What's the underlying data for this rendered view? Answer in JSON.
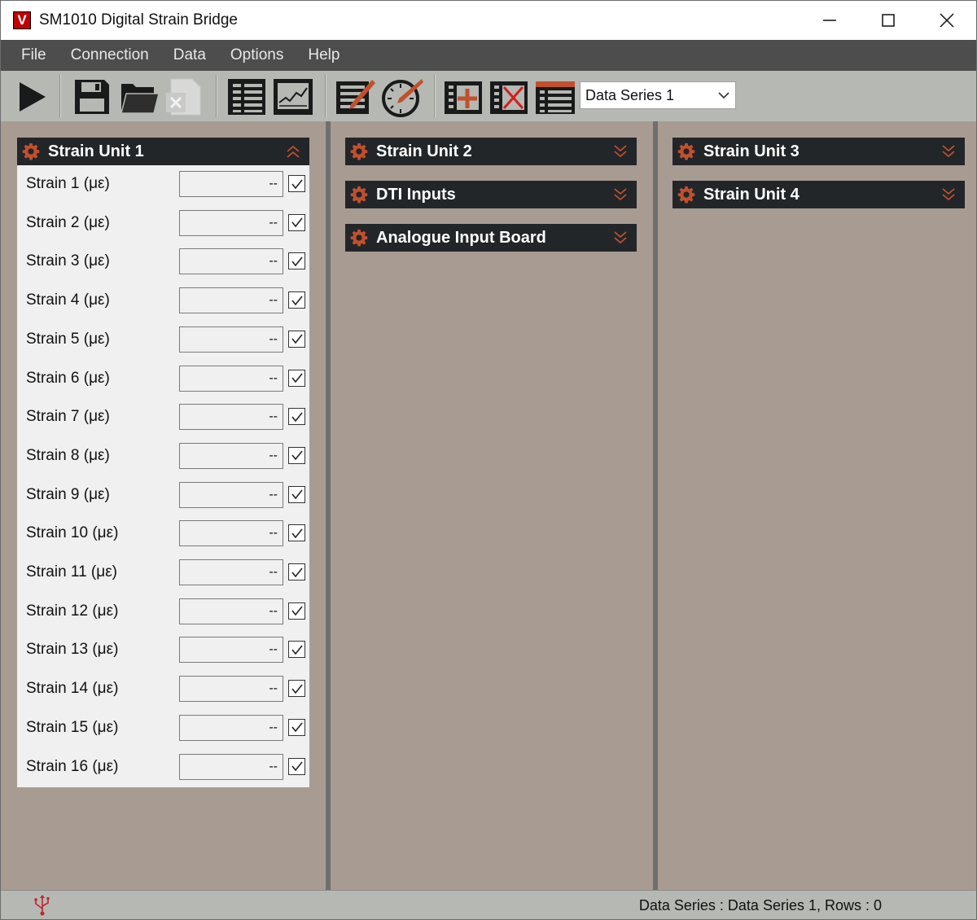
{
  "window": {
    "title": "SM1010 Digital Strain Bridge",
    "logo_letter": "V"
  },
  "menu": [
    "File",
    "Connection",
    "Data",
    "Options",
    "Help"
  ],
  "toolbar": {
    "data_series_selected": "Data Series 1",
    "icons": [
      "play-icon",
      "save-icon",
      "open-folder-icon",
      "export-excel-icon",
      "table-view-icon",
      "chart-view-icon",
      "edit-table-icon",
      "gauge-icon",
      "add-column-icon",
      "delete-column-icon",
      "table-icon"
    ]
  },
  "colors": {
    "accent": "#c0502e",
    "header_bg": "#222629",
    "workspace_bg": "#a89b92",
    "menu_bg": "#4d4d4d",
    "toolbar_bg": "#b5b8b3"
  },
  "panels": {
    "strain_unit_1": {
      "title": "Strain Unit 1",
      "expanded": true,
      "rows": [
        {
          "label": "Strain 1  (με)",
          "value": "--",
          "checked": true
        },
        {
          "label": "Strain 2  (με)",
          "value": "--",
          "checked": true
        },
        {
          "label": "Strain 3  (με)",
          "value": "--",
          "checked": true
        },
        {
          "label": "Strain 4  (με)",
          "value": "--",
          "checked": true
        },
        {
          "label": "Strain 5  (με)",
          "value": "--",
          "checked": true
        },
        {
          "label": "Strain 6  (με)",
          "value": "--",
          "checked": true
        },
        {
          "label": "Strain 7  (με)",
          "value": "--",
          "checked": true
        },
        {
          "label": "Strain 8  (με)",
          "value": "--",
          "checked": true
        },
        {
          "label": "Strain 9  (με)",
          "value": "--",
          "checked": true
        },
        {
          "label": "Strain 10  (με)",
          "value": "--",
          "checked": true
        },
        {
          "label": "Strain 11  (με)",
          "value": "--",
          "checked": true
        },
        {
          "label": "Strain 12  (με)",
          "value": "--",
          "checked": true
        },
        {
          "label": "Strain 13  (με)",
          "value": "--",
          "checked": true
        },
        {
          "label": "Strain 14  (με)",
          "value": "--",
          "checked": true
        },
        {
          "label": "Strain 15  (με)",
          "value": "--",
          "checked": true
        },
        {
          "label": "Strain 16  (με)",
          "value": "--",
          "checked": true
        }
      ]
    },
    "strain_unit_2": {
      "title": "Strain Unit 2"
    },
    "dti_inputs": {
      "title": "DTI Inputs"
    },
    "analogue_input_board": {
      "title": "Analogue Input Board"
    },
    "strain_unit_3": {
      "title": "Strain Unit 3"
    },
    "strain_unit_4": {
      "title": "Strain Unit 4"
    }
  },
  "status": {
    "text": "Data Series : Data Series 1,  Rows : 0"
  }
}
